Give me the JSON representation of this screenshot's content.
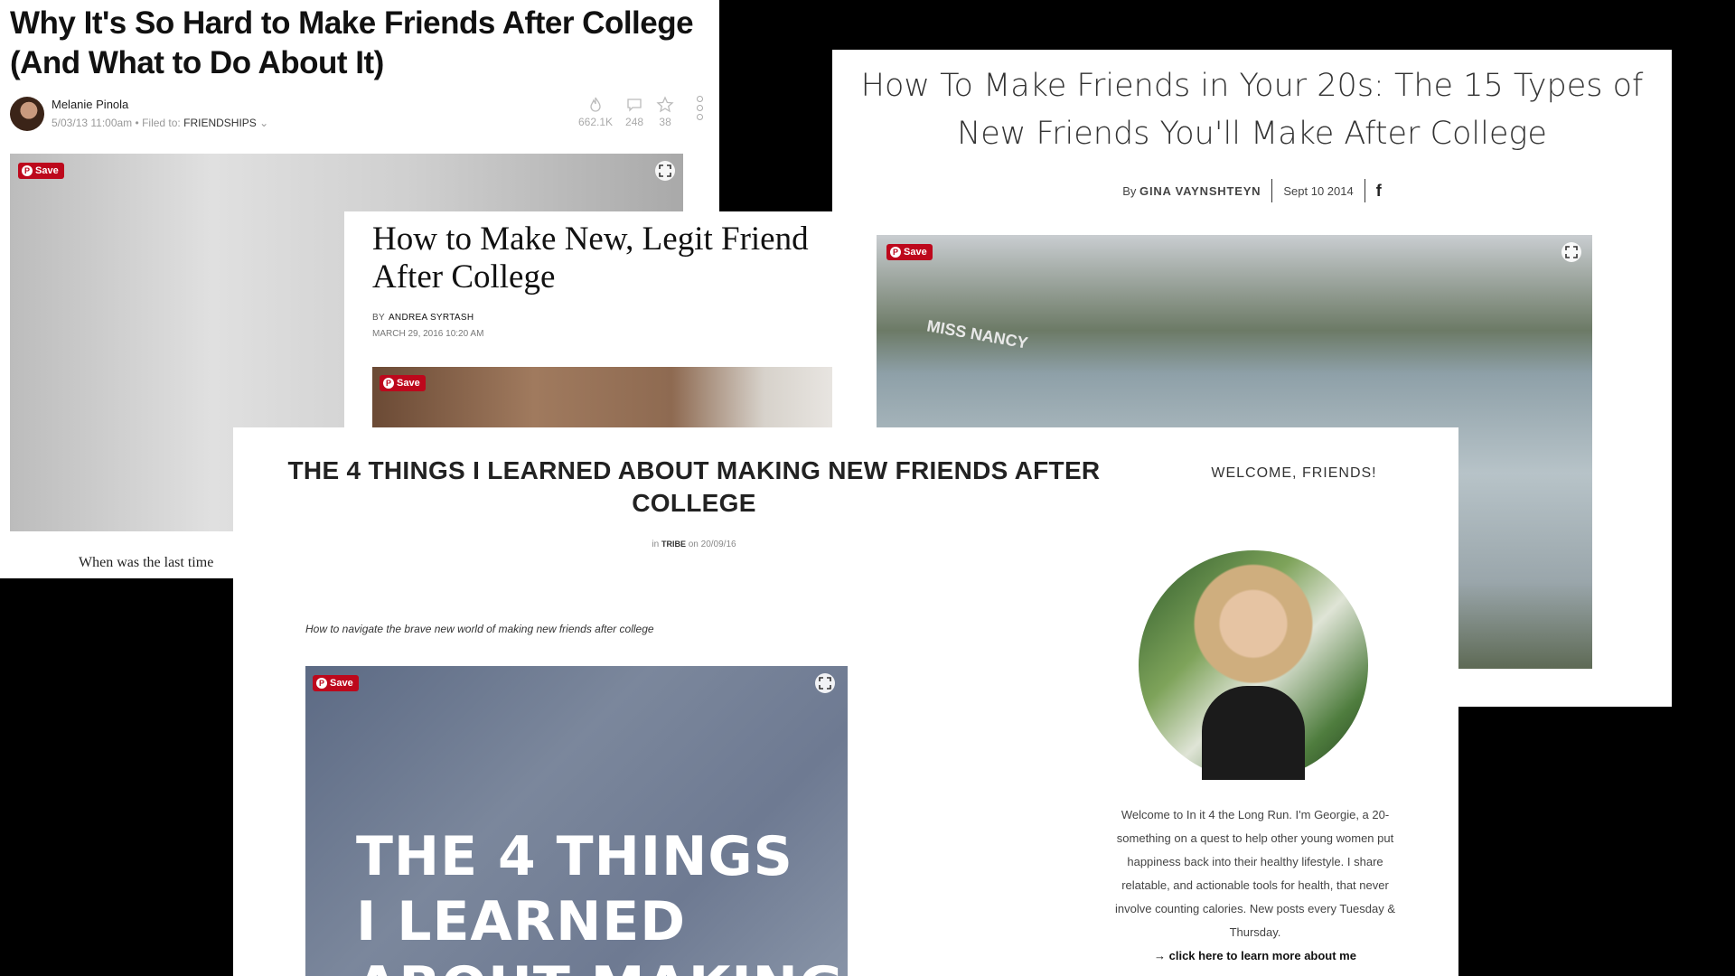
{
  "article1": {
    "title": "Why It's So Hard to Make Friends After College (And What to Do About It)",
    "author": "Melanie Pinola",
    "date": "5/03/13 11:00am",
    "filed_label": "Filed to:",
    "category": "FRIENDSHIPS",
    "stats": {
      "views": "662.1K",
      "comments": "248",
      "stars": "38"
    },
    "save_label": "Save",
    "lede": "When was the last time"
  },
  "article2": {
    "title": "How to Make New, Legit Friend After College",
    "by_label": "BY",
    "author": "ANDREA SYRTASH",
    "date": "MARCH 29, 2016 10:20 AM",
    "save_label": "Save"
  },
  "article3": {
    "title": "How To Make Friends in Your 20s: The 15 Types of New Friends You'll Make After College",
    "by_label": "By",
    "author": "GINA VAYNSHTEYN",
    "date": "Sept 10 2014",
    "save_label": "Save",
    "boat_name": "MISS NANCY"
  },
  "article4": {
    "title": "THE 4 THINGS I LEARNED ABOUT MAKING NEW FRIENDS AFTER COLLEGE",
    "in_label": "in",
    "category": "TRIBE",
    "on_label": "on",
    "date": "20/09/16",
    "excerpt": "How to navigate the brave new world of making new friends after college",
    "save_label": "Save",
    "overlay_lines": [
      "THE 4 THINGS",
      "I LEARNED",
      "ABOUT MAKING"
    ],
    "sidebar_title": "WELCOME, FRIENDS!",
    "about_text": "Welcome to In it 4 the Long Run. I'm Georgie, a 20-something on a quest to help other young women put happiness back into their healthy lifestyle. I share relatable, and actionable tools for health, that never involve counting calories. New posts every Tuesday & Thursday.",
    "about_link": "→ click here to learn more about me"
  }
}
